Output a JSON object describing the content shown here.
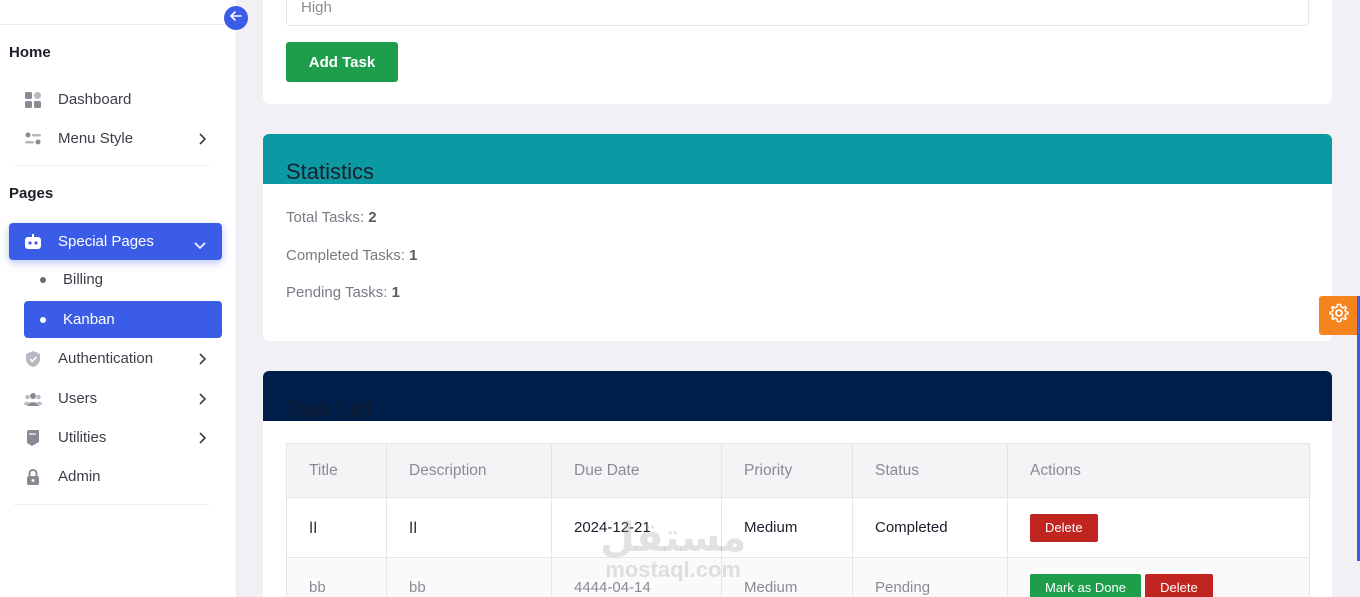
{
  "sidebar": {
    "home_title": "Home",
    "pages_title": "Pages",
    "items": [
      {
        "label": "Dashboard",
        "icon": "dashboard-icon"
      },
      {
        "label": "Menu Style",
        "icon": "menu-style-icon"
      },
      {
        "label": "Special Pages",
        "icon": "special-pages-icon"
      },
      {
        "label": "Authentication",
        "icon": "shield-icon"
      },
      {
        "label": "Users",
        "icon": "users-icon"
      },
      {
        "label": "Utilities",
        "icon": "utilities-icon"
      },
      {
        "label": "Admin",
        "icon": "lock-icon"
      }
    ],
    "subitems": [
      {
        "label": "Billing"
      },
      {
        "label": "Kanban"
      }
    ]
  },
  "form": {
    "priority_value": "High",
    "add_button": "Add Task"
  },
  "statistics": {
    "title": "Statistics",
    "total_label": "Total Tasks:",
    "total_value": "2",
    "completed_label": "Completed Tasks:",
    "completed_value": "1",
    "pending_label": "Pending Tasks:",
    "pending_value": "1",
    "header_color": "#0b9aa3"
  },
  "task_list": {
    "title": "Task List",
    "header_color": "#001e4a",
    "columns": [
      "Title",
      "Description",
      "Due Date",
      "Priority",
      "Status",
      "Actions"
    ],
    "rows": [
      {
        "title": "اا",
        "description": "اا",
        "due": "2024-12-21",
        "priority": "Medium",
        "status": "Completed",
        "delete": "Delete"
      },
      {
        "title": "bb",
        "description": "bb",
        "due": "4444-04-14",
        "priority": "Medium",
        "status": "Pending",
        "done": "Mark as Done",
        "delete": "Delete"
      }
    ]
  },
  "watermark": {
    "arabic": "مستقل",
    "latin": "mostaql.com"
  },
  "colors": {
    "accent": "#3b5ce6",
    "success": "#1e9e4a",
    "danger": "#c0261f",
    "settings": "#f5841f"
  }
}
